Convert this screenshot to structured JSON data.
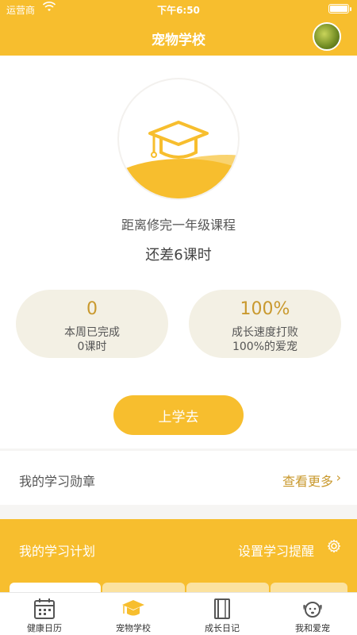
{
  "status_bar": {
    "carrier": "运营商",
    "time": "下午6:50"
  },
  "header": {
    "title": "宠物学校"
  },
  "course": {
    "progress_label": "距离修完一年级课程",
    "remaining": "还差6课时"
  },
  "stats": [
    {
      "value": "0",
      "line1": "本周已完成",
      "line2": "0课时"
    },
    {
      "value": "100%",
      "line1": "成长速度打败",
      "line2": "100%的爱宠"
    }
  ],
  "go_button": "上学去",
  "badges": {
    "label": "我的学习勋章",
    "more": "查看更多"
  },
  "plan": {
    "label": "我的学习计划",
    "reminder": "设置学习提醒"
  },
  "nav": [
    {
      "label": "健康日历",
      "icon": "calendar-icon"
    },
    {
      "label": "宠物学校",
      "icon": "graduation-cap-icon",
      "active": true
    },
    {
      "label": "成长日记",
      "icon": "diary-icon"
    },
    {
      "label": "我和爱宠",
      "icon": "dog-icon"
    }
  ],
  "colors": {
    "accent": "#f7be2e",
    "accent_text": "#c9992e",
    "stat_bg": "#f3f0e4"
  }
}
